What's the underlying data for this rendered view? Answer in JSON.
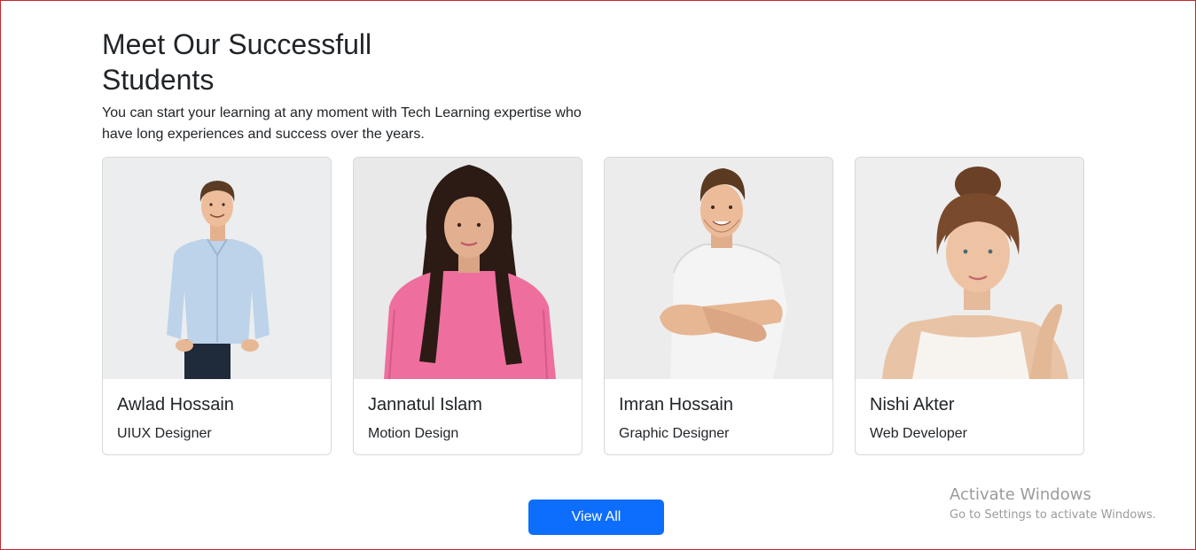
{
  "section": {
    "title": "Meet Our Successfull Students",
    "subtitle": "You can start your learning at any moment with Tech Learning expertise who have long experiences and success over the years."
  },
  "students": [
    {
      "name": "Awlad Hossain",
      "role": "UIUX Designer"
    },
    {
      "name": "Jannatul Islam",
      "role": "Motion Design"
    },
    {
      "name": "Imran Hossain",
      "role": "Graphic Designer"
    },
    {
      "name": "Nishi Akter",
      "role": "Web Developer"
    }
  ],
  "cta": {
    "label": "View All"
  },
  "watermark": {
    "title": "Activate Windows",
    "subtitle": "Go to Settings to activate Windows."
  },
  "colors": {
    "accent": "#0d6efd",
    "frame": "#c1272d",
    "text": "#212529"
  }
}
